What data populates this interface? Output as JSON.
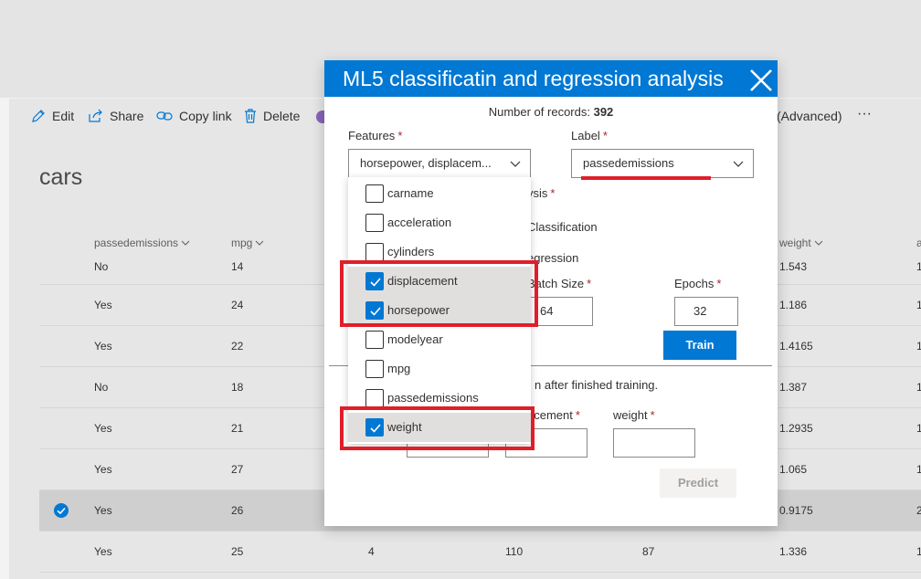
{
  "toolbar": {
    "edit": "Edit",
    "share": "Share",
    "copy_link": "Copy link",
    "delete": "Delete",
    "advanced": "(Advanced)",
    "more": "···"
  },
  "list": {
    "title": "cars",
    "columns": [
      "passedemissions",
      "mpg",
      "weight"
    ],
    "rows": [
      {
        "passedemissions": "No",
        "mpg": "14",
        "c3": "",
        "c4": "",
        "c5": "",
        "weight": "1.543"
      },
      {
        "passedemissions": "Yes",
        "mpg": "24",
        "c3": "",
        "c4": "",
        "c5": "",
        "weight": "1.186"
      },
      {
        "passedemissions": "Yes",
        "mpg": "22",
        "c3": "",
        "c4": "",
        "c5": "",
        "weight": "1.4165"
      },
      {
        "passedemissions": "No",
        "mpg": "18",
        "c3": "",
        "c4": "",
        "c5": "",
        "weight": "1.387"
      },
      {
        "passedemissions": "Yes",
        "mpg": "21",
        "c3": "",
        "c4": "",
        "c5": "",
        "weight": "1.2935"
      },
      {
        "passedemissions": "Yes",
        "mpg": "27",
        "c3": "",
        "c4": "",
        "c5": "",
        "weight": "1.065"
      },
      {
        "passedemissions": "Yes",
        "mpg": "26",
        "c3": "",
        "c4": "",
        "c5": "",
        "weight": "0.9175"
      },
      {
        "passedemissions": "Yes",
        "mpg": "25",
        "c3": "4",
        "c4": "110",
        "c5": "87",
        "weight": "1.336"
      }
    ],
    "right_edge_values": [
      "1",
      "1",
      "1",
      "1",
      "1",
      "1",
      "2",
      "1"
    ]
  },
  "modal": {
    "title": "ML5 classificatin and regression analysis",
    "records_label": "Number of records:",
    "records_count": "392",
    "features_label": "Features",
    "features_value": "horsepower, displacem...",
    "label_label": "Label",
    "label_value": "passedemissions",
    "analysis_label": "ysis",
    "classification_label": "Classification",
    "regression_label": "egression",
    "batch_size_label": "Batch Size",
    "batch_size_value": "64",
    "epochs_label": "Epochs",
    "epochs_value": "32",
    "train_button": "Train",
    "finished_text": "n after finished training.",
    "displacement_label": "acement",
    "weight_label": "weight",
    "predict_button": "Predict",
    "required_mark": "*"
  },
  "features_options": [
    {
      "label": "carname",
      "checked": false
    },
    {
      "label": "acceleration",
      "checked": false
    },
    {
      "label": "cylinders",
      "checked": false
    },
    {
      "label": "displacement",
      "checked": true
    },
    {
      "label": "horsepower",
      "checked": true
    },
    {
      "label": "modelyear",
      "checked": false
    },
    {
      "label": "mpg",
      "checked": false
    },
    {
      "label": "passedemissions",
      "checked": false
    },
    {
      "label": "weight",
      "checked": true
    }
  ],
  "colors": {
    "accent": "#0078d4",
    "annotation": "#e01e29",
    "checked_option_bg": "#e1dfdd"
  },
  "icons": {
    "edit": "pencil-icon",
    "share": "share-icon",
    "copy_link": "link-icon",
    "delete": "trash-icon",
    "close": "close-icon",
    "dropdown": "chevron-down-icon",
    "checkbox": "checkmark-icon"
  }
}
